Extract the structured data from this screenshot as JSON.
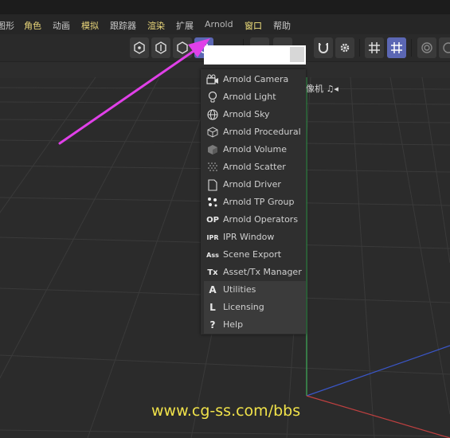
{
  "menubar": {
    "items": [
      {
        "label": "图形",
        "style": "plain"
      },
      {
        "label": "角色",
        "style": "yellow"
      },
      {
        "label": "动画",
        "style": "plain"
      },
      {
        "label": "模拟",
        "style": "yellow"
      },
      {
        "label": "跟踪器",
        "style": "plain"
      },
      {
        "label": "渲染",
        "style": "yellow"
      },
      {
        "label": "扩展",
        "style": "plain"
      },
      {
        "label": "Arnold",
        "style": "arnold"
      },
      {
        "label": "窗口",
        "style": "active"
      },
      {
        "label": "帮助",
        "style": "plain"
      }
    ]
  },
  "viewport": {
    "camera_label": "像机 ♫◂"
  },
  "arnold_menu": {
    "items": [
      {
        "label": "Arnold Camera",
        "icon": "camera-icon"
      },
      {
        "label": "Arnold Light",
        "icon": "lightbulb-icon"
      },
      {
        "label": "Arnold Sky",
        "icon": "globe-icon"
      },
      {
        "label": "Arnold Procedural",
        "icon": "cube-outline-icon"
      },
      {
        "label": "Arnold Volume",
        "icon": "volume-cube-icon"
      },
      {
        "label": "Arnold Scatter",
        "icon": "scatter-icon"
      },
      {
        "label": "Arnold Driver",
        "icon": "document-icon"
      },
      {
        "label": "Arnold TP Group",
        "icon": "tp-group-icon"
      },
      {
        "label": "Arnold Operators",
        "icon": "op-icon",
        "glyph": "OP"
      },
      {
        "label": "IPR Window",
        "icon": "ipr-icon",
        "glyph": "IPR"
      },
      {
        "label": "Scene Export",
        "icon": "ass-icon",
        "glyph": "Ass"
      },
      {
        "label": "Asset/Tx Manager",
        "icon": "tx-icon",
        "glyph": "Tx"
      },
      {
        "label": "Utilities",
        "icon": "utilities-icon",
        "glyph": "A"
      },
      {
        "label": "Licensing",
        "icon": "licensing-icon",
        "glyph": "L"
      },
      {
        "label": "Help",
        "icon": "help-icon",
        "glyph": "?"
      }
    ]
  },
  "watermark": "www.cg-ss.com/bbs",
  "colors": {
    "accent": "#5b67b4",
    "menu_yellow": "#e9d67a",
    "annotation_arrow": "#e040e8",
    "axis_green": "#3fae5a",
    "axis_blue": "#3a56c8",
    "axis_red": "#c04040",
    "watermark": "#f0e24a"
  }
}
